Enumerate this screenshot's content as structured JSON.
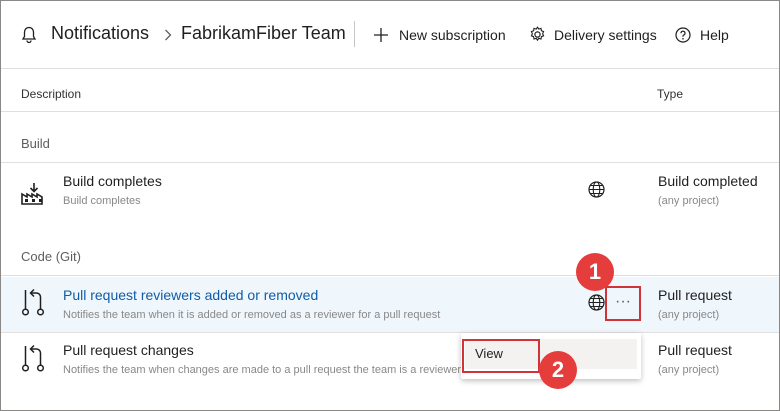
{
  "header": {
    "bell_icon": "bell-icon",
    "breadcrumb_root": "Notifications",
    "breadcrumb_separator_icon": "chevron-right-icon",
    "breadcrumb_team": "FabrikamFiber Team",
    "new_subscription": "New subscription",
    "delivery_settings": "Delivery settings",
    "help": "Help"
  },
  "columns": {
    "description": "Description",
    "type": "Type"
  },
  "groups": [
    {
      "label": "Build",
      "rows": [
        {
          "icon": "build-icon",
          "title": "Build completes",
          "subtitle": "Build completes",
          "scope_icon": "globe-icon",
          "type": "Build completed",
          "project": "(any project)"
        }
      ]
    },
    {
      "label": "Code (Git)",
      "rows": [
        {
          "icon": "pull-request-icon",
          "title": "Pull request reviewers added or removed",
          "subtitle": "Notifies the team when it is added or removed as a reviewer for a pull request",
          "scope_icon": "globe-icon",
          "more_label": "···",
          "type": "Pull request",
          "project": "(any project)",
          "selected": true
        },
        {
          "icon": "pull-request-icon",
          "title": "Pull request changes",
          "subtitle": "Notifies the team when changes are made to a pull request the team is a reviewer",
          "type": "Pull request",
          "project": "(any project)"
        }
      ]
    }
  ],
  "context_menu": {
    "items": [
      "View"
    ]
  },
  "callouts": [
    "1",
    "2"
  ],
  "colors": {
    "accent_link": "#0f5ca8",
    "selected_row": "#eff6fc",
    "callout": "#e53c3c",
    "highlight_box": "#d13438"
  }
}
